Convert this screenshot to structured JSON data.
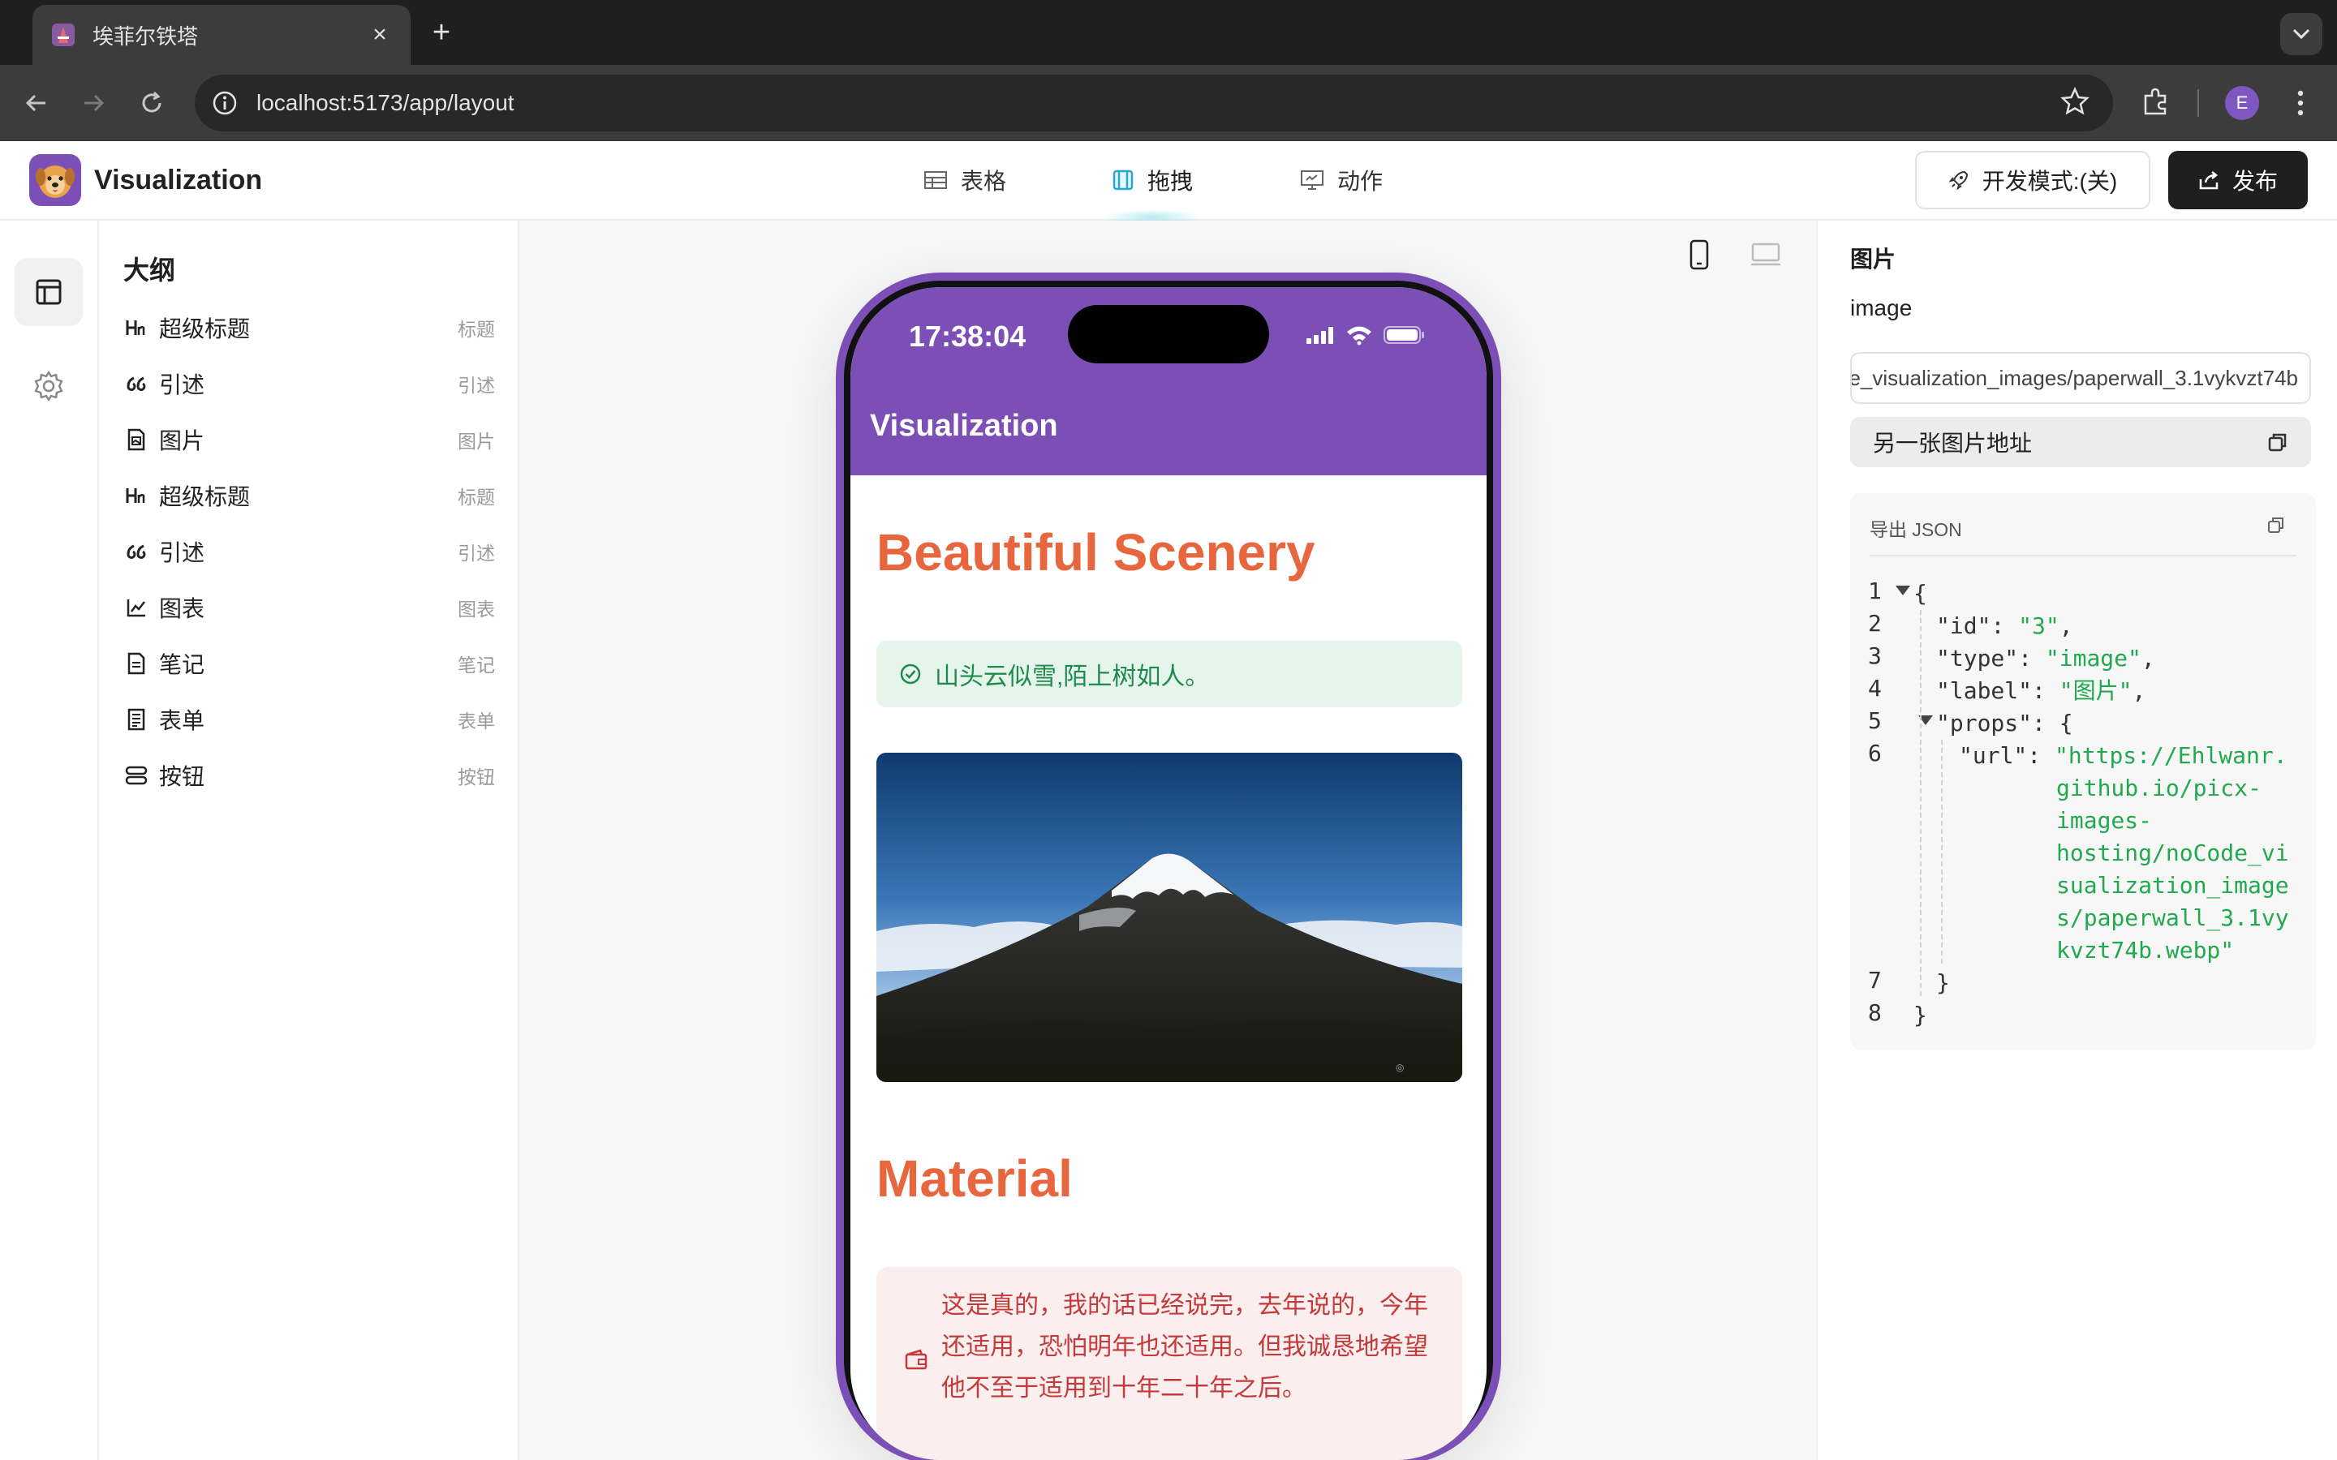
{
  "browser": {
    "tab_title": "埃菲尔铁塔",
    "url": "localhost:5173/app/layout",
    "profile_initial": "E"
  },
  "app": {
    "name": "Visualization",
    "nav": [
      {
        "label": "表格",
        "icon": "table-icon"
      },
      {
        "label": "拖拽",
        "icon": "drag-layout-icon"
      },
      {
        "label": "动作",
        "icon": "monitor-icon"
      }
    ],
    "dev_mode_label": "开发模式:(关)",
    "publish_label": "发布"
  },
  "outline": {
    "title": "大纲",
    "items": [
      {
        "label": "超级标题",
        "tag": "标题",
        "icon": "heading-icon"
      },
      {
        "label": "引述",
        "tag": "引述",
        "icon": "quote-icon"
      },
      {
        "label": "图片",
        "tag": "图片",
        "icon": "image-file-icon"
      },
      {
        "label": "超级标题",
        "tag": "标题",
        "icon": "heading-icon"
      },
      {
        "label": "引述",
        "tag": "引述",
        "icon": "quote-icon"
      },
      {
        "label": "图表",
        "tag": "图表",
        "icon": "chart-icon"
      },
      {
        "label": "笔记",
        "tag": "笔记",
        "icon": "note-icon"
      },
      {
        "label": "表单",
        "tag": "表单",
        "icon": "form-icon"
      },
      {
        "label": "按钮",
        "tag": "按钮",
        "icon": "button-icon"
      }
    ]
  },
  "phone": {
    "time": "17:38:04",
    "app_title": "Visualization",
    "heading1": "Beautiful Scenery",
    "success_text": "山头云似雪,陌上树如人。",
    "heading2": "Material",
    "quote_text": "这是真的，我的话已经说完，去年说的，今年还适用，恐怕明年也还适用。但我诚恳地希望他不至于适用到十年二十年之后。"
  },
  "props_panel": {
    "title": "图片",
    "subtitle": "image",
    "url_value": "https://Ehlwanr.github.io/picx-images-hosting/noCode_visualization_images/paperwall_3.1vykvzt74b",
    "alt_button_label": "另一张图片地址",
    "json_header": "导出 JSON"
  },
  "json_lines": {
    "l1": "{",
    "l2_key": "\"id\"",
    "l2_val": "\"3\"",
    "l3_key": "\"type\"",
    "l3_val": "\"image\"",
    "l4_key": "\"label\"",
    "l4_val": "\"图片\"",
    "l5_key": "\"props\"",
    "l6_key": "\"url\"",
    "l6_val_1": "\"https://Ehlwanr.",
    "l6_val_2": "github.io/picx-",
    "l6_val_3": "images-",
    "l6_val_4": "hosting/noCode_vi",
    "l6_val_5": "sualization_image",
    "l6_val_6": "s/paperwall_3.1vy",
    "l6_val_7": "kvzt74b.webp\"",
    "l7": "}",
    "l8": "}"
  },
  "colors": {
    "brand_purple": "#7b4fb6",
    "heading_orange": "#e8663d",
    "success_green": "#1f8a4c",
    "quote_red": "#c43a3a"
  }
}
